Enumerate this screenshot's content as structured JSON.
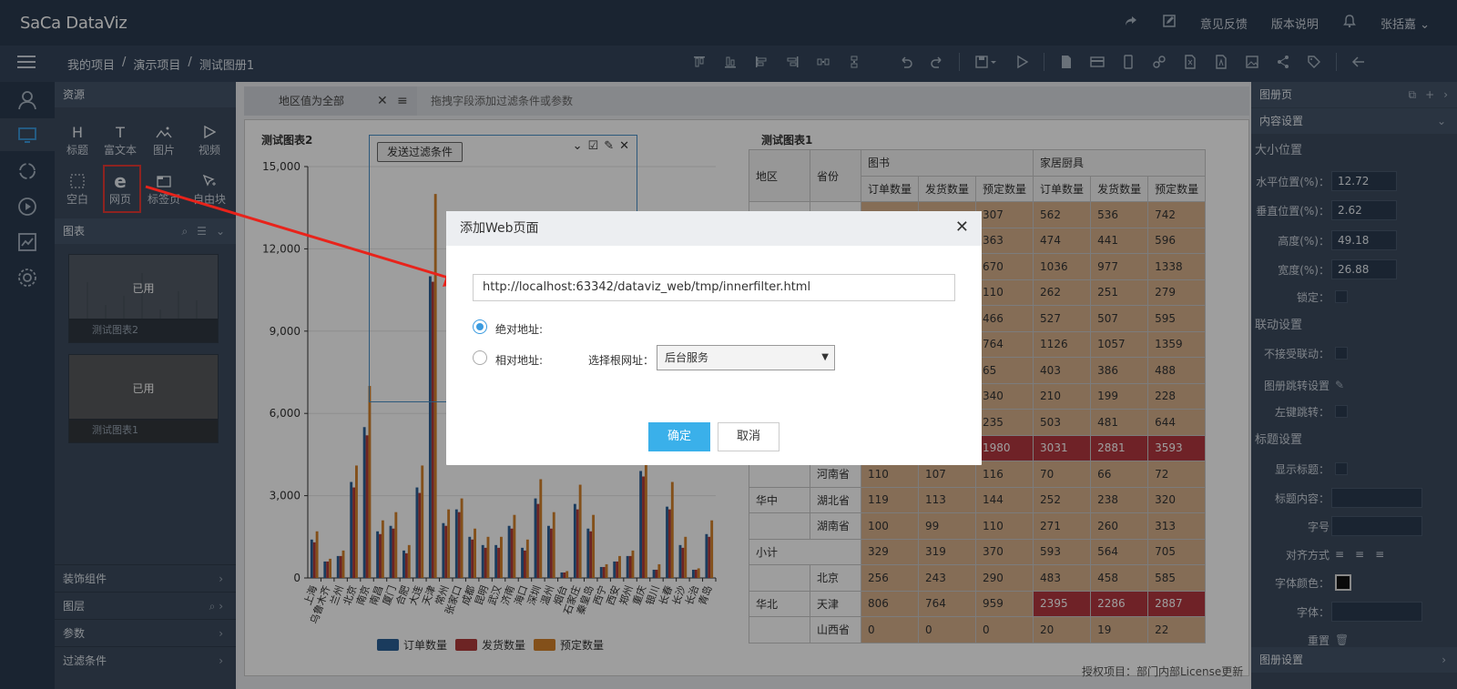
{
  "app": {
    "logo": "SaCa DataViz",
    "top_actions": [
      "意见反馈",
      "版本说明"
    ],
    "user": "张括嘉"
  },
  "breadcrumb": [
    "我的项目",
    "演示项目",
    "测试图册1"
  ],
  "left_nav_icons": [
    "user-icon",
    "monitor-icon",
    "refresh-icon",
    "play-icon",
    "chart-icon",
    "gear-icon"
  ],
  "resources": {
    "title": "资源",
    "items": [
      "标题",
      "富文本",
      "图片",
      "视频",
      "空白",
      "网页",
      "标签页",
      "自由块"
    ],
    "charts_title": "图表",
    "thumbnails": [
      {
        "status": "已用",
        "name": "测试图表2"
      },
      {
        "status": "已用",
        "name": "测试图表1"
      }
    ],
    "accordions": [
      "装饰组件",
      "图层",
      "参数",
      "过滤条件"
    ]
  },
  "filter": {
    "chip": "地区值为全部",
    "hint": "拖拽字段添加过滤条件或参数"
  },
  "chart2": {
    "title": "测试图表2",
    "send_filter_btn": "发送过滤条件"
  },
  "chart_data": {
    "type": "bar",
    "title": "测试图表2",
    "xlabel": "",
    "ylabel": "",
    "ylim": [
      0,
      15000
    ],
    "yticks": [
      0,
      3000,
      6000,
      9000,
      12000,
      15000
    ],
    "ytick_labels": [
      "0",
      "3,000",
      "6,000",
      "9,000",
      "12,000",
      "15,000"
    ],
    "categories": [
      "上海",
      "乌鲁木齐",
      "兰州",
      "北京",
      "南京",
      "南昌",
      "厦门",
      "合肥",
      "大连",
      "天津",
      "常州",
      "张家口",
      "成都",
      "昆明",
      "武汉",
      "济南",
      "海口",
      "深圳",
      "温州",
      "烟台",
      "石家庄",
      "秦皇岛",
      "西宁",
      "西安",
      "郑州",
      "重庆",
      "银川",
      "长春",
      "长沙",
      "长治",
      "青岛"
    ],
    "series": [
      {
        "name": "订单数量",
        "color": "#2a5f96",
        "values": [
          1400,
          600,
          800,
          3500,
          5500,
          1700,
          1900,
          1000,
          3300,
          11000,
          2000,
          2500,
          1500,
          1200,
          1200,
          1900,
          1100,
          2900,
          1900,
          200,
          2700,
          1800,
          400,
          600,
          800,
          3900,
          300,
          2600,
          1200,
          300,
          1600
        ]
      },
      {
        "name": "发货数量",
        "color": "#b03a3a",
        "values": [
          1300,
          600,
          800,
          3300,
          5200,
          1600,
          1800,
          900,
          3100,
          10800,
          1900,
          2400,
          1400,
          1100,
          1100,
          1800,
          1000,
          2700,
          1800,
          200,
          2500,
          1700,
          400,
          600,
          800,
          3700,
          300,
          2500,
          1100,
          300,
          1500
        ]
      },
      {
        "name": "预定数量",
        "color": "#d4822a",
        "values": [
          1700,
          700,
          1000,
          4100,
          7000,
          2100,
          2400,
          1200,
          4100,
          14000,
          2500,
          2900,
          1800,
          1500,
          1500,
          2300,
          1400,
          3600,
          2400,
          250,
          3400,
          2300,
          500,
          800,
          1000,
          4700,
          500,
          3500,
          1500,
          350,
          2100
        ]
      }
    ],
    "legend_position": "bottom"
  },
  "table": {
    "title": "测试图表1",
    "head_row1": [
      "地区",
      "省份",
      "图书",
      "家居厨具"
    ],
    "head_row2": [
      "订单数量",
      "发货数量",
      "预定数量",
      "订单数量",
      "发货数量",
      "预定数量"
    ],
    "rows": [
      {
        "region": "",
        "province": "",
        "vals": [
          "",
          "",
          "307",
          "562",
          "536",
          "742"
        ],
        "red": []
      },
      {
        "region": "",
        "province": "",
        "vals": [
          "",
          "",
          "363",
          "474",
          "441",
          "596"
        ],
        "red": []
      },
      {
        "region": "",
        "province": "",
        "vals": [
          "",
          "",
          "670",
          "1036",
          "977",
          "1338"
        ],
        "red": []
      },
      {
        "region": "",
        "province": "",
        "vals": [
          "",
          "",
          "110",
          "262",
          "251",
          "279"
        ],
        "red": []
      },
      {
        "region": "",
        "province": "",
        "vals": [
          "",
          "",
          "466",
          "527",
          "507",
          "595"
        ],
        "red": []
      },
      {
        "region": "",
        "province": "",
        "vals": [
          "",
          "",
          "764",
          "1126",
          "1057",
          "1359"
        ],
        "red": []
      },
      {
        "region": "",
        "province": "",
        "vals": [
          "",
          "",
          "65",
          "403",
          "386",
          "488"
        ],
        "red": []
      },
      {
        "region": "",
        "province": "",
        "vals": [
          "",
          "",
          "340",
          "210",
          "199",
          "228"
        ],
        "red": []
      },
      {
        "region": "",
        "province": "",
        "vals": [
          "",
          "",
          "235",
          "503",
          "481",
          "644"
        ],
        "red": []
      },
      {
        "region": "",
        "province": "",
        "vals": [
          "",
          "",
          "1980",
          "3031",
          "2881",
          "3593"
        ],
        "red": [
          2,
          3,
          4,
          5
        ]
      },
      {
        "region": "",
        "province": "河南省",
        "vals": [
          "110",
          "107",
          "116",
          "70",
          "66",
          "72"
        ],
        "red": []
      },
      {
        "region": "华中",
        "province": "湖北省",
        "vals": [
          "119",
          "113",
          "144",
          "252",
          "238",
          "320"
        ],
        "red": []
      },
      {
        "region": "",
        "province": "湖南省",
        "vals": [
          "100",
          "99",
          "110",
          "271",
          "260",
          "313"
        ],
        "red": []
      },
      {
        "region": "小计",
        "province": "",
        "vals": [
          "329",
          "319",
          "370",
          "593",
          "564",
          "705"
        ],
        "red": [],
        "subtotal": true
      },
      {
        "region": "",
        "province": "北京",
        "vals": [
          "256",
          "243",
          "290",
          "483",
          "458",
          "585"
        ],
        "red": []
      },
      {
        "region": "华北",
        "province": "天津",
        "vals": [
          "806",
          "764",
          "959",
          "2395",
          "2286",
          "2887"
        ],
        "red": [
          3,
          4,
          5
        ]
      },
      {
        "region": "",
        "province": "山西省",
        "vals": [
          "0",
          "0",
          "0",
          "20",
          "19",
          "22"
        ],
        "red": []
      }
    ]
  },
  "right_panel": {
    "title": "图册页",
    "content_settings": "内容设置",
    "size_position": "大小位置",
    "h_pos_label": "水平位置(%)：",
    "h_pos": "12.72",
    "v_pos_label": "垂直位置(%)：",
    "v_pos": "2.62",
    "height_label": "高度(%)：",
    "height": "49.18",
    "width_label": "宽度(%)：",
    "width": "26.88",
    "lock_label": "锁定：",
    "linkage": "联动设置",
    "no_linkage_label": "不接受联动：",
    "jump_label": "图册跳转设置",
    "left_jump_label": "左键跳转：",
    "title_settings": "标题设置",
    "show_title_label": "显示标题：",
    "title_content_label": "标题内容：",
    "font_size_label": "字号",
    "align_label": "对齐方式",
    "font_color_label": "字体颜色：",
    "font_label": "字体：",
    "reset_label": "重置",
    "album_settings": "图册设置"
  },
  "dialog": {
    "title": "添加Web页面",
    "url": "http://localhost:63342/dataviz_web/tmp/innerfilter.html",
    "abs_label": "绝对地址:",
    "rel_label": "相对地址:",
    "root_label": "选择根网址：",
    "root_value": "后台服务",
    "ok": "确定",
    "cancel": "取消"
  },
  "footer": "授权项目：部门内部License更新"
}
